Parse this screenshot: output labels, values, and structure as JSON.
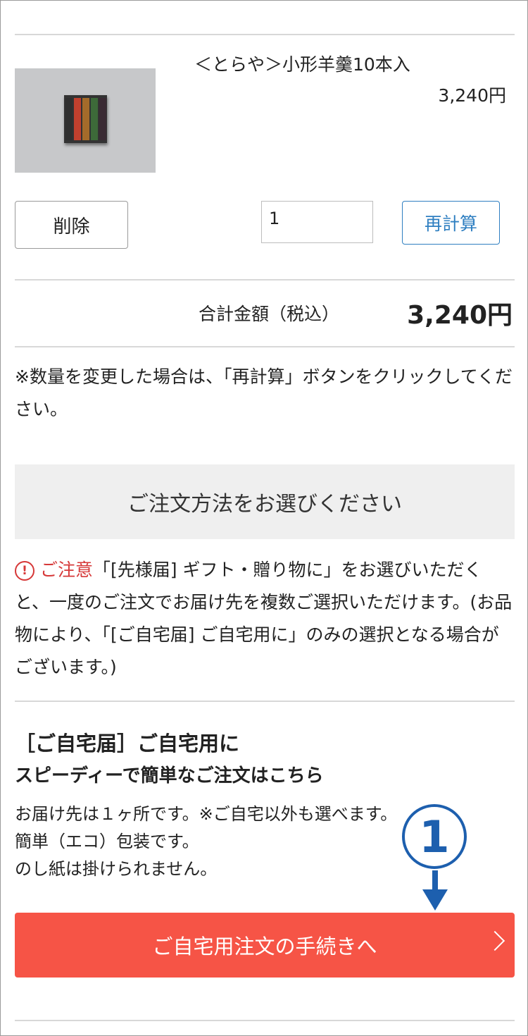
{
  "product": {
    "name": "＜とらや＞小形羊羹10本入",
    "price": "3,240円",
    "image_alt": "小形羊羹10本入 箱",
    "stick_colors": [
      "#2f2f2f",
      "#c1402e",
      "#a46b2a",
      "#3d6a39",
      "#3a2a33"
    ]
  },
  "actions": {
    "delete_label": "削除",
    "quantity_value": "1",
    "recalc_label": "再計算"
  },
  "total": {
    "label": "合計金額（税込）",
    "value": "3,240円"
  },
  "note": "※数量を変更した場合は、「再計算」ボタンをクリックしてください。",
  "order_method": {
    "title": "ご注文方法をお選びください"
  },
  "caution": {
    "icon": "!",
    "label": "ご注意",
    "text": "「[先様届] ギフト・贈り物に」をお選びいただくと、一度のご注文でお届け先を複数ご選択いただけます。(お品物により、「[ご自宅届] ご自宅用に」のみの選択となる場合がございます。)"
  },
  "home_delivery": {
    "title": "［ご自宅届］ご自宅用に",
    "subtitle": "スピーディーで簡単なご注文はこちら",
    "lines": [
      "お届け先は１ヶ所です。※ご自宅以外も選べます。",
      "簡単（エコ）包装です。",
      "のし紙は掛けられません。"
    ],
    "button_label": "ご自宅用注文の手続きへ"
  },
  "annotation": {
    "badge": "1"
  },
  "colors": {
    "accent_blue": "#2f7fc1",
    "order_red": "#f65446",
    "caution_red": "#d63838",
    "annotation_blue": "#1d5fae"
  }
}
